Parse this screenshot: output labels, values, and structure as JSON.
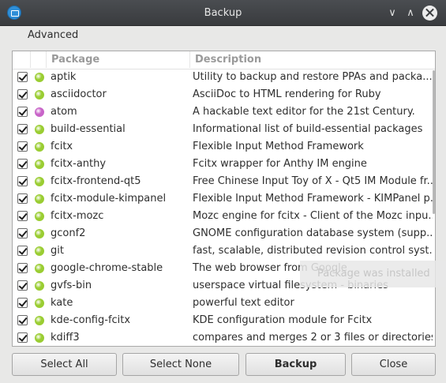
{
  "window": {
    "title": "Backup"
  },
  "window_controls": {
    "minimize_glyph": "∨",
    "maximize_glyph": "∧"
  },
  "menu": {
    "items": [
      "Advanced"
    ]
  },
  "table": {
    "columns": [
      "Package",
      "Description"
    ],
    "rows": [
      {
        "checked": true,
        "status": "installed",
        "package": "aptik",
        "description": "Utility to backup and restore PPAs and packa..."
      },
      {
        "checked": true,
        "status": "installed",
        "package": "asciidoctor",
        "description": "AsciiDoc to HTML rendering for Ruby"
      },
      {
        "checked": true,
        "status": "extra",
        "package": "atom",
        "description": "A hackable text editor for the 21st Century."
      },
      {
        "checked": true,
        "status": "installed",
        "package": "build-essential",
        "description": "Informational list of build-essential packages"
      },
      {
        "checked": true,
        "status": "installed",
        "package": "fcitx",
        "description": "Flexible Input Method Framework"
      },
      {
        "checked": true,
        "status": "installed",
        "package": "fcitx-anthy",
        "description": "Fcitx wrapper for Anthy IM engine"
      },
      {
        "checked": true,
        "status": "installed",
        "package": "fcitx-frontend-qt5",
        "description": "Free Chinese Input Toy of X - Qt5 IM Module fr..."
      },
      {
        "checked": true,
        "status": "installed",
        "package": "fcitx-module-kimpanel",
        "description": "Flexible Input Method Framework - KIMPanel p..."
      },
      {
        "checked": true,
        "status": "installed",
        "package": "fcitx-mozc",
        "description": "Mozc engine for fcitx - Client of the Mozc inpu..."
      },
      {
        "checked": true,
        "status": "installed",
        "package": "gconf2",
        "description": "GNOME configuration database system (supp..."
      },
      {
        "checked": true,
        "status": "installed",
        "package": "git",
        "description": "fast, scalable, distributed revision control syst..."
      },
      {
        "checked": true,
        "status": "installed",
        "package": "google-chrome-stable",
        "description": "The web browser from Google"
      },
      {
        "checked": true,
        "status": "installed",
        "package": "gvfs-bin",
        "description": "userspace virtual filesystem - binaries"
      },
      {
        "checked": true,
        "status": "installed",
        "package": "kate",
        "description": "powerful text editor"
      },
      {
        "checked": true,
        "status": "installed",
        "package": "kde-config-fcitx",
        "description": "KDE configuration module for Fcitx"
      },
      {
        "checked": true,
        "status": "installed",
        "package": "kdiff3",
        "description": "compares and merges 2 or 3 files or directories"
      }
    ]
  },
  "tooltip": {
    "text": "Package was installed"
  },
  "buttons": {
    "select_all": "Select All",
    "select_none": "Select None",
    "backup": "Backup",
    "close": "Close"
  },
  "colors": {
    "status_installed": "#9acd32",
    "status_extra": "#c864c8",
    "titlebar": "#3e4043"
  }
}
